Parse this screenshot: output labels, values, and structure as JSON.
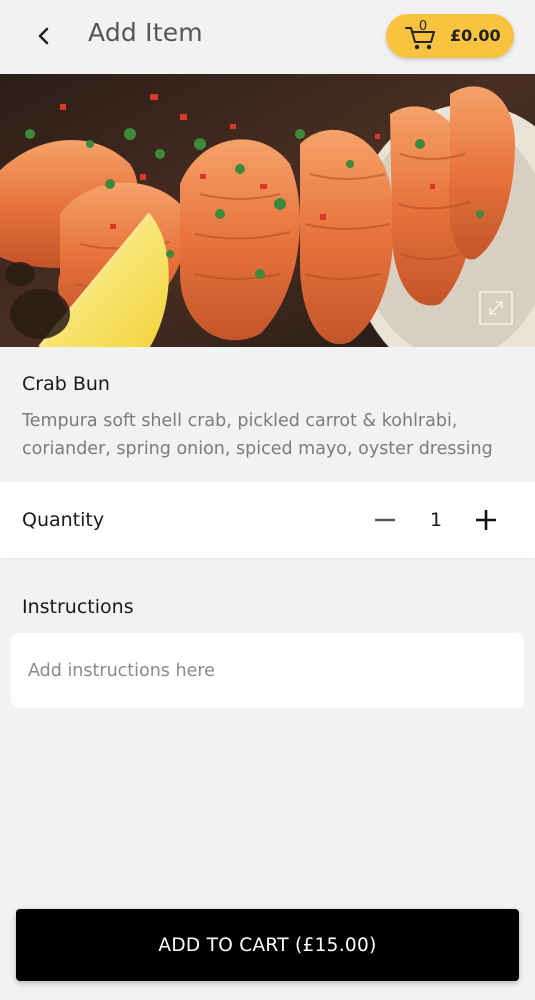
{
  "header": {
    "title": "Add Item",
    "back_icon": "chevron-left-icon",
    "cart": {
      "count": "0",
      "total": "£0.00",
      "icon": "cart-icon",
      "color": "#f9c33f"
    }
  },
  "hero": {
    "subject": "grilled prawns with lemon",
    "expand_icon": "expand-icon"
  },
  "item": {
    "name": "Crab Bun",
    "description": "Tempura soft shell crab, pickled carrot & kohlrabi, coriander, spring onion, spiced mayo, oyster dressing"
  },
  "quantity": {
    "label": "Quantity",
    "value": "1",
    "minus_icon": "minus-icon",
    "plus_icon": "plus-icon"
  },
  "instructions": {
    "heading": "Instructions",
    "placeholder": "Add instructions here"
  },
  "footer": {
    "add_button_label": "ADD TO CART (£15.00)"
  }
}
